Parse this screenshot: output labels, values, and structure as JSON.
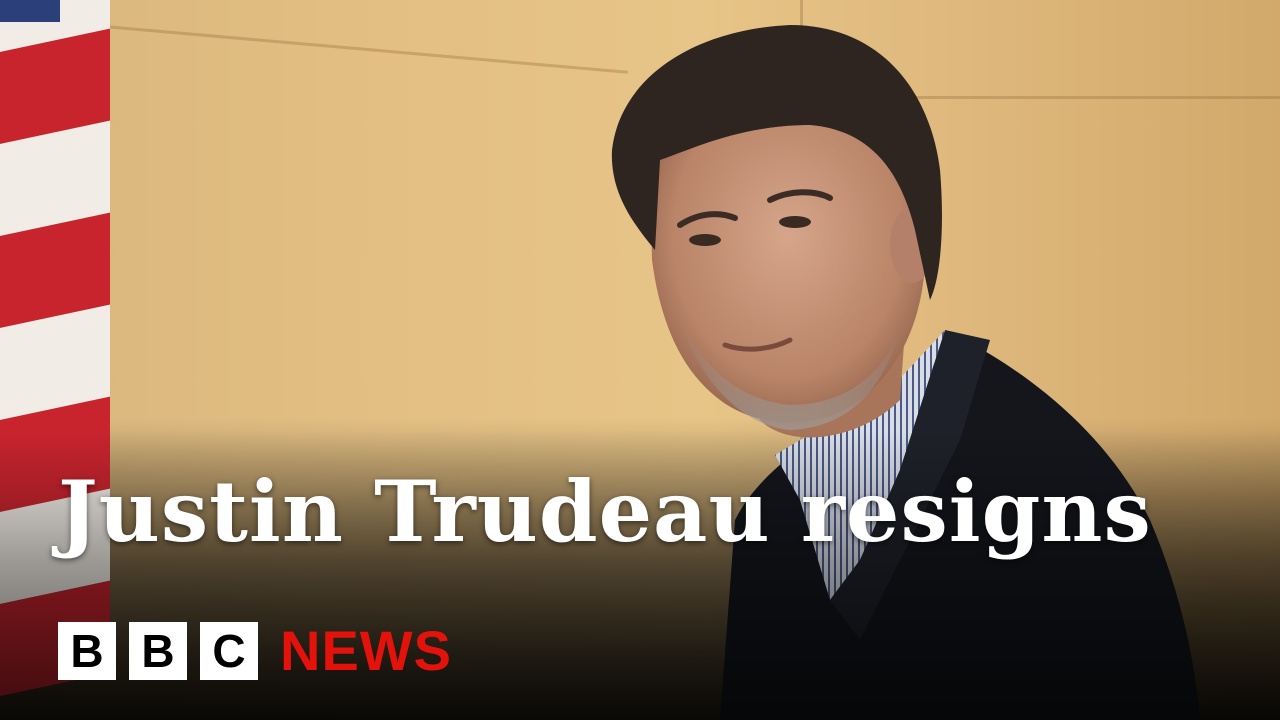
{
  "headline": "Justin Trudeau resigns",
  "logo": {
    "letters": [
      "B",
      "B",
      "C"
    ],
    "news": "NEWS"
  },
  "colors": {
    "wall": "#e3bf83",
    "news_red": "#e3120b",
    "headline_text": "#ffffff"
  }
}
